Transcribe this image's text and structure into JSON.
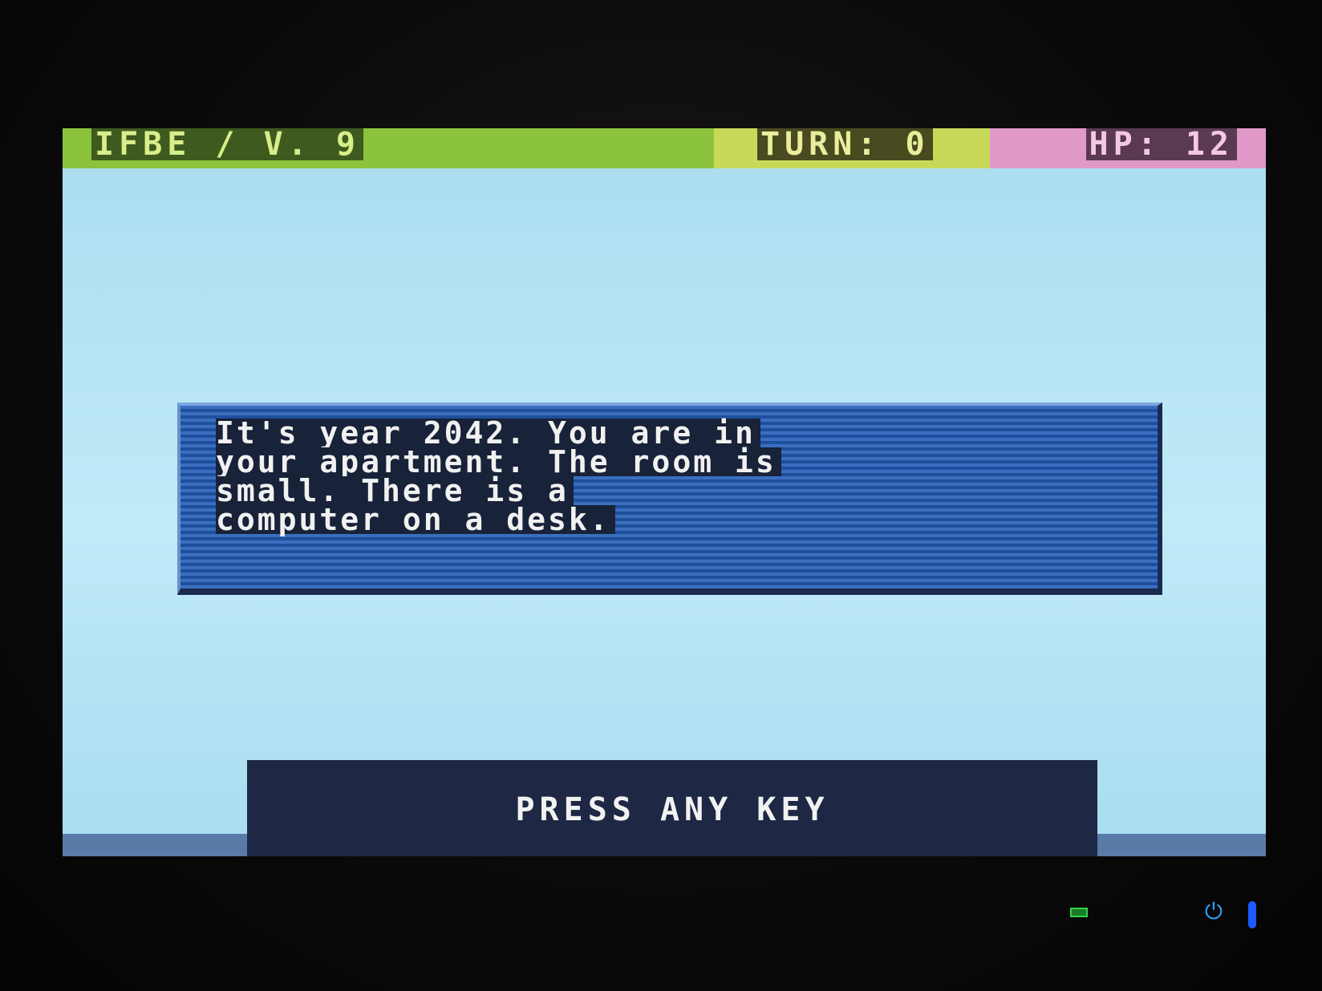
{
  "status_bar": {
    "title": "IFBE / V. 9",
    "turn": "TURN: 0",
    "hp": "HP: 12"
  },
  "dialog": {
    "lines": [
      "It's year 2042. You are in",
      "your apartment. The room is",
      "small. There is a",
      "computer on a desk."
    ]
  },
  "footer": {
    "prompt": "PRESS ANY KEY"
  },
  "colors": {
    "status_green": "#8cc33c",
    "status_yellow": "#c8d95a",
    "status_pink": "#e099c8",
    "screen_bg": "#b9e6f5",
    "dialog_blue": "#2a5fae",
    "footer_navy": "#1e2844"
  },
  "icons": {
    "battery": "battery-led-icon",
    "power": "power-button-icon"
  }
}
